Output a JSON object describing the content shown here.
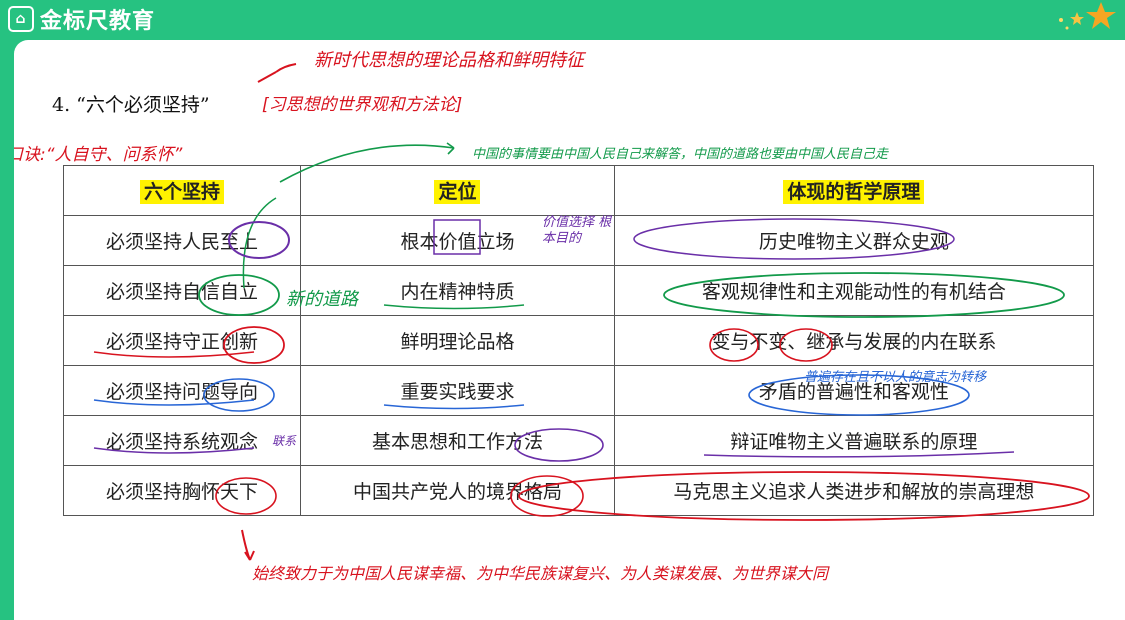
{
  "brand": {
    "name": "金标尺教育",
    "logo_glyph": "⌂"
  },
  "heading": {
    "text": "4. “六个必须坚持”"
  },
  "table": {
    "headers": [
      "六个坚持",
      "定位",
      "体现的哲学原理"
    ],
    "rows": [
      [
        "必须坚持人民至上",
        "根本价值立场",
        "历史唯物主义群众史观"
      ],
      [
        "必须坚持自信自立",
        "内在精神特质",
        "客观规律性和主观能动性的有机结合"
      ],
      [
        "必须坚持守正创新",
        "鲜明理论品格",
        "变与不变、继承与发展的内在联系"
      ],
      [
        "必须坚持问题导向",
        "重要实践要求",
        "矛盾的普遍性和客观性"
      ],
      [
        "必须坚持系统观念",
        "基本思想和工作方法",
        "辩证唯物主义普遍联系的原理"
      ],
      [
        "必须坚持胸怀天下",
        "中国共产党人的境界格局",
        "马克思主义追求人类进步和解放的崇高理想"
      ]
    ]
  },
  "annotations": {
    "top_red": "新时代思想的理论品格和鲜明特征",
    "heading_red": "[习思想的世界观和方法论]",
    "mnemonic": "口诀:“人自守、问系怀”",
    "green_top": "中国的事情要由中国人民自己来解答，中国的道路也要由中国人民自己走",
    "purple_side": "价值选择 根本目的",
    "green_side": "新的道路",
    "blue_side": "普遍存在且不以人的意志为转移",
    "purple_small": "联系",
    "bottom_red": "始终致力于为中国人民谋幸福、为中华民族谋复兴、为人类谋发展、为世界谋大同"
  },
  "colors": {
    "brand_green": "#26c281",
    "highlight": "#fff200",
    "ink_red": "#d8131f",
    "ink_green": "#129a4a",
    "ink_purple": "#6a2fa8",
    "ink_blue": "#2866d6"
  }
}
